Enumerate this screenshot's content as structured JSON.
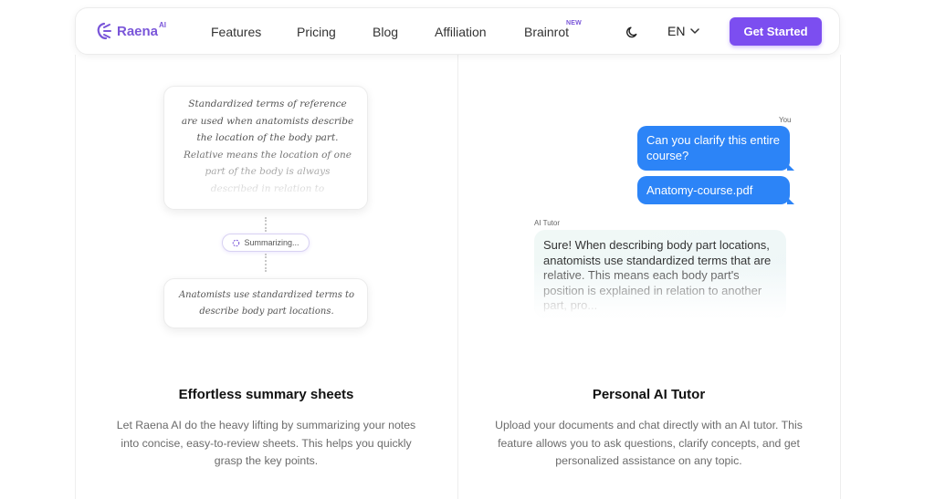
{
  "nav": {
    "logo_text": "Raena",
    "logo_sup": "AI",
    "links": [
      "Features",
      "Pricing",
      "Blog",
      "Affiliation",
      "Brainrot"
    ],
    "new_badge": "NEW",
    "language": "EN",
    "cta_label": "Get Started",
    "theme_icon": "moon-icon"
  },
  "left_feature": {
    "note_text": "Standardized terms of reference are used when anatomists describe the location of the body part. Relative means the location of one part of the body is always described in relation to",
    "summarizing_label": "Summarizing...",
    "summary_text": "Anatomists use standardized terms to describe body part locations.",
    "title": "Effortless summary sheets",
    "description": "Let Raena AI do the heavy lifting by summarizing your notes into concise, easy-to-review sheets. This helps you quickly grasp the key points."
  },
  "right_feature": {
    "you_label": "You",
    "user_message_1": "Can you clarify this entire course?",
    "user_message_2": "Anatomy-course.pdf",
    "tutor_label": "AI Tutor",
    "ai_message": "Sure! When describing body part locations, anatomists use standardized terms that are relative. This means each body part's position is explained in relation to another part, pro...",
    "title": "Personal AI Tutor",
    "description": "Upload your documents and chat directly with an AI tutor. This feature allows you to ask questions, clarify concepts, and get personalized assistance on any topic."
  },
  "colors": {
    "brand": "#7a56d9",
    "cta_bg": "#7c4ef0",
    "user_bubble": "#2c84f7",
    "ai_bubble": "#eef6f5"
  }
}
